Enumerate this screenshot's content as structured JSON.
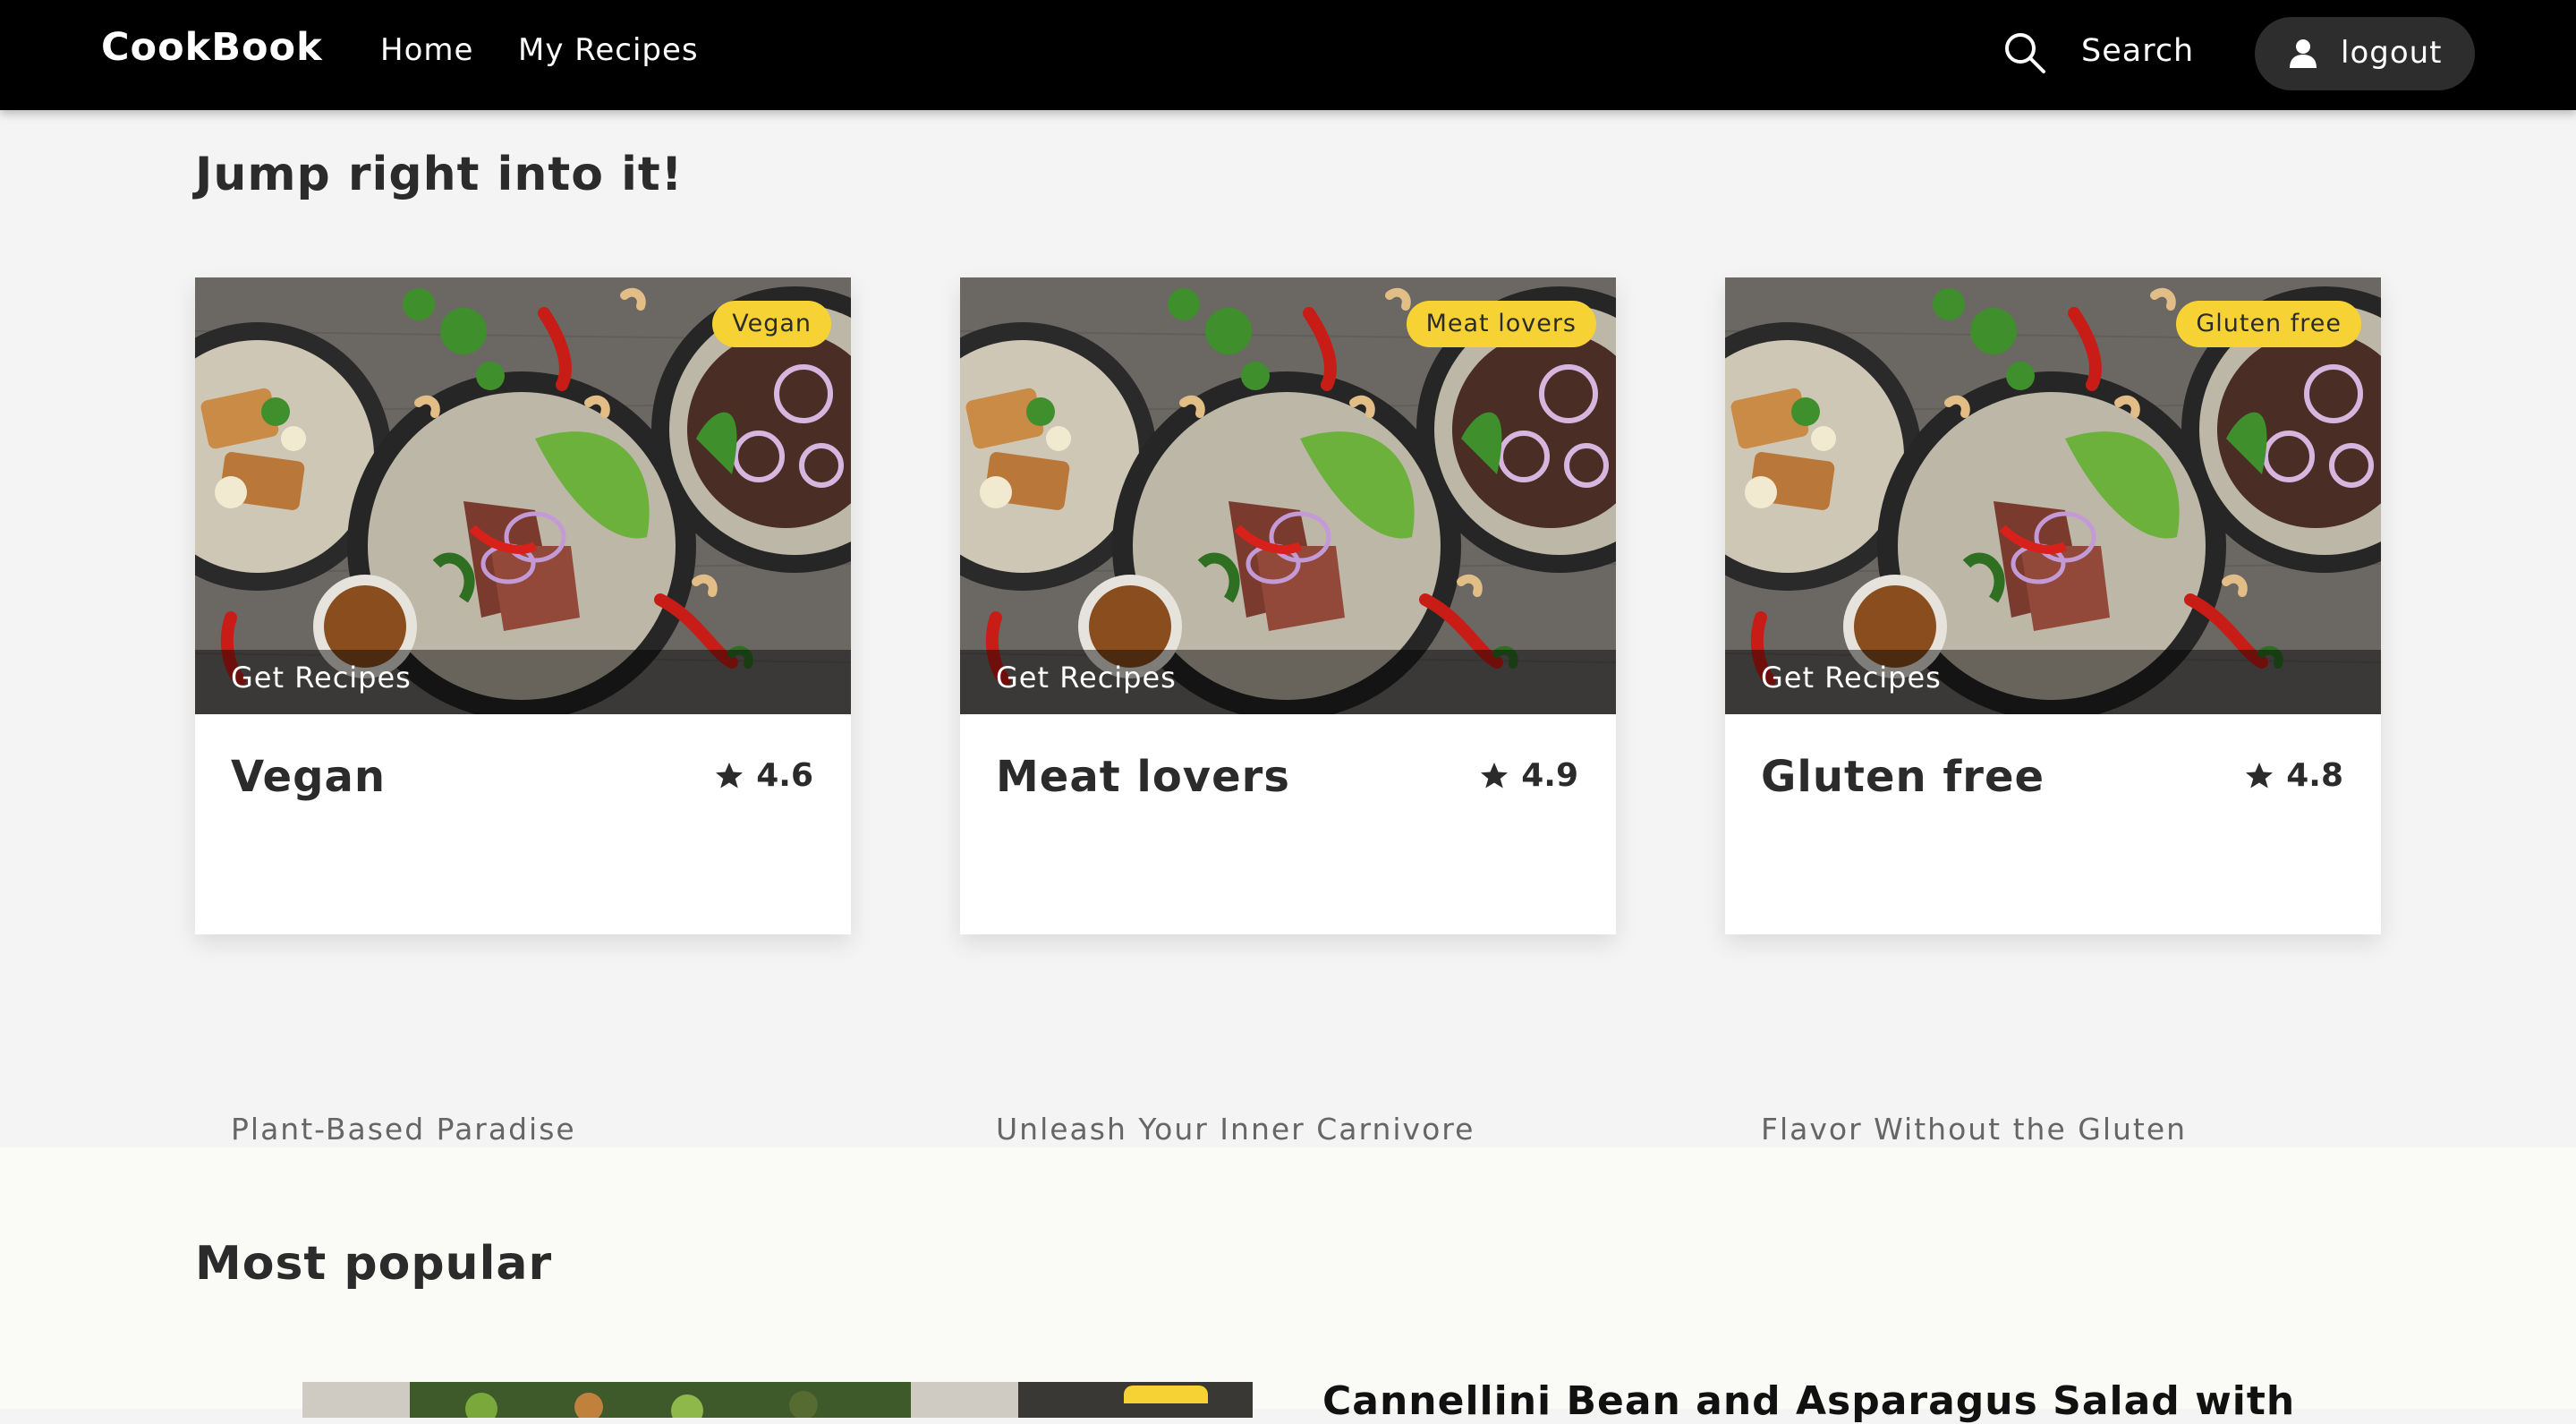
{
  "nav": {
    "brand": "CookBook",
    "links": [
      "Home",
      "My Recipes"
    ],
    "search_label": "Search",
    "logout_label": "logout"
  },
  "jump": {
    "title": "Jump right into it!",
    "cards": [
      {
        "badge": "Vegan",
        "overlay": "Get Recipes",
        "title": "Vegan",
        "rating": "4.6",
        "subtitle": "Plant-Based Paradise"
      },
      {
        "badge": "Meat lovers",
        "overlay": "Get Recipes",
        "title": "Meat lovers",
        "rating": "4.9",
        "subtitle": "Unleash Your Inner Carnivore"
      },
      {
        "badge": "Gluten free",
        "overlay": "Get Recipes",
        "title": "Gluten free",
        "rating": "4.8",
        "subtitle": "Flavor Without the Gluten"
      }
    ]
  },
  "popular": {
    "title": "Most popular",
    "recipe_title": "Cannellini Bean and Asparagus Salad with"
  },
  "colors": {
    "navbar": "#000000",
    "badge": "#f7d235",
    "page_background": "#f4f4f4",
    "popular_background": "#fafaf7"
  },
  "icons": [
    "search-icon",
    "user-icon",
    "star-icon"
  ]
}
